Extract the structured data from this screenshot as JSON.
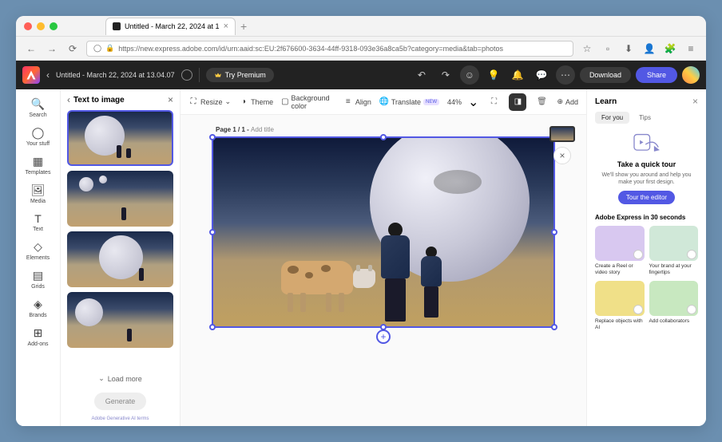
{
  "browser": {
    "tab_title": "Untitled - March 22, 2024 at 1",
    "url": "https://new.express.adobe.com/id/urn:aaid:sc:EU:2f676600-3634-44ff-9318-093e36a8ca5b?category=media&tab=photos"
  },
  "header": {
    "doc_title": "Untitled - March 22, 2024 at 13.04.07",
    "premium": "Try Premium",
    "download": "Download",
    "share": "Share"
  },
  "rail": {
    "items": [
      "Search",
      "Your stuff",
      "Templates",
      "Media",
      "Text",
      "Elements",
      "Grids",
      "Brands",
      "Add-ons"
    ]
  },
  "t2i": {
    "title": "Text to image",
    "load_more": "Load more",
    "generate": "Generate",
    "terms": "Adobe Generative AI terms"
  },
  "toolbar": {
    "resize": "Resize",
    "theme": "Theme",
    "bgcolor": "Background color",
    "align": "Align",
    "translate": "Translate",
    "new_badge": "NEW",
    "zoom": "44%",
    "add": "Add"
  },
  "canvas": {
    "page_label_prefix": "Page 1 / 1 - ",
    "page_label_action": "Add title"
  },
  "learn": {
    "title": "Learn",
    "tabs": [
      "For you",
      "Tips"
    ],
    "tour": {
      "title": "Take a quick tour",
      "desc": "We'll show you around and help you make your first design.",
      "button": "Tour the editor"
    },
    "section_title": "Adobe Express in 30 seconds",
    "cards": [
      "Create a Reel or video story",
      "Your brand at your fingertips",
      "Replace objects with AI",
      "Add collaborators"
    ]
  }
}
